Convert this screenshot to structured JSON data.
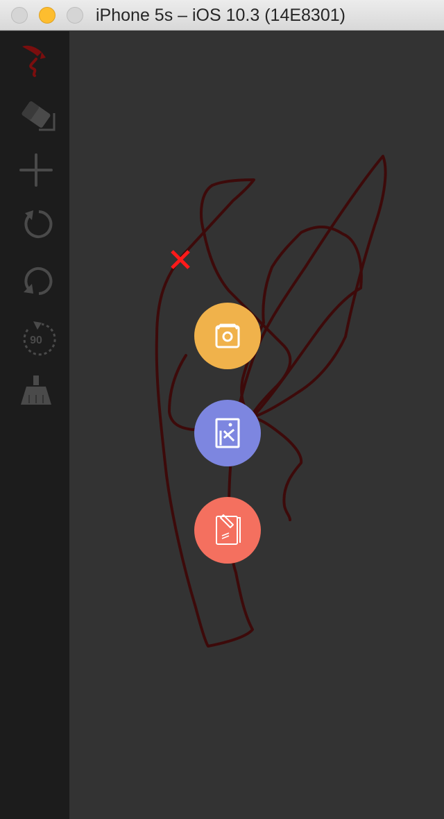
{
  "window": {
    "title": "iPhone 5s – iOS 10.3 (14E8301)",
    "controls": [
      "close-button",
      "minimize-button",
      "zoom-button"
    ]
  },
  "toolbar": {
    "tools": [
      {
        "name": "brush",
        "icon": "brush-icon",
        "selected": true
      },
      {
        "name": "eraser",
        "icon": "eraser-icon",
        "selected": false
      },
      {
        "name": "add",
        "icon": "plus-icon",
        "selected": false
      },
      {
        "name": "redo",
        "icon": "redo-icon",
        "selected": false
      },
      {
        "name": "undo",
        "icon": "undo-icon",
        "selected": false
      },
      {
        "name": "rotate-90",
        "icon": "rotate-90-icon",
        "label": "90",
        "selected": false
      },
      {
        "name": "clear",
        "icon": "broom-icon",
        "selected": false
      }
    ]
  },
  "menu": {
    "close_icon": "close-icon",
    "buttons": [
      {
        "name": "camera",
        "icon": "camera-icon",
        "color": "#f0b24b"
      },
      {
        "name": "gallery",
        "icon": "gallery-icon",
        "color": "#7d86e0"
      },
      {
        "name": "note",
        "icon": "note-edit-icon",
        "color": "#f4705f"
      }
    ]
  },
  "colors": {
    "titlebar": "#e3e3e3",
    "toolbar": "#1c1c1c",
    "canvas": "#333333",
    "stroke": "#3d0a0a",
    "close": "#ff1a1a",
    "icon_disabled": "#4a4a4a",
    "brush_active": "#7a0e0e"
  }
}
